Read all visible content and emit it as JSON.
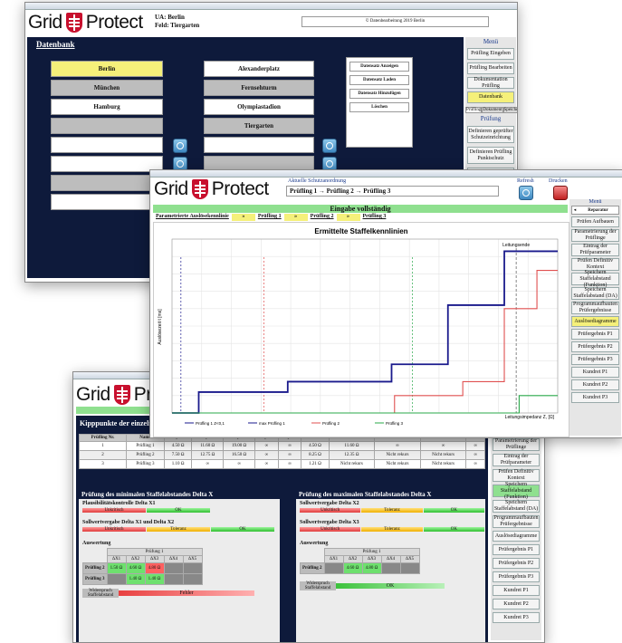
{
  "colors": {
    "navy": "#0e1a3b",
    "yellow": "#f5f07a",
    "green": "#8fe08f",
    "red": "#c8102e",
    "blue_series": "#1a1a8c",
    "red_series": "#e05050",
    "green_series": "#2aa84a"
  },
  "back_window": {
    "logo": {
      "left": "Grid",
      "right": "Protect"
    },
    "header_info": {
      "line1": "UA: Berlin",
      "line2": "Feld: Tiergarten"
    },
    "header_field": "© Datenbearbeitung 2019 Berlin",
    "db_title": "Datenbank",
    "col1": [
      "Berlin",
      "München",
      "Hamburg",
      "",
      ""
    ],
    "col2": [
      "Alexanderplatz",
      "Fernsehturm",
      "Olympiastadion",
      "Tiergarten",
      ""
    ],
    "actions": [
      "Datensatz Anzeigen",
      "Datensatz Laden",
      "Datensatz Hinzufügen",
      "Löschen"
    ],
    "menu_title": "Menü",
    "menu": [
      "Prüfling Eingeben",
      "Prüfling Bearbeiten",
      "Dokumentation Prüfling",
      "Datenbank"
    ],
    "tabs": [
      "Prüfling",
      "Dokument",
      "Speicher"
    ],
    "pruefung_title": "Prüfung",
    "pruefung_items": [
      "Definieren geprüfter Schutzeinrichtung",
      "Definieren Prüfling Punktschutz",
      "Definieren Prüfling Reserveschutz"
    ]
  },
  "mid_window": {
    "logo": {
      "left": "Grid",
      "right": "Protect"
    },
    "top_label": "Aktuelle Schutzanordnung",
    "sequence": "Prüfling 1 → Prüfling 2 → Prüfling 3",
    "icons": [
      {
        "label": "Refresh"
      },
      {
        "label": "Drucken"
      }
    ],
    "status_bar": "Eingabe vollständig",
    "param_row": {
      "label": "Parametrierte Auslösekennlinie",
      "items": [
        "Prüfling 1",
        "Prüfling 2",
        "Prüfling 3"
      ]
    },
    "chart_title": "Ermittelte Staffelkennlinien",
    "menu_title": "Menü",
    "menu_selected": "Reparatur",
    "menu": [
      "Prüfen Aufbauen",
      "Parametrierung der Prüflinge",
      "Eintrag der Prüfparameter",
      "Prüfen Definitiv Kontext",
      "Speichern Staffelabstand (Funktion)",
      "Speichern Staffelabstand (DA)",
      "Programmaufbauten Prüfergebnisse",
      "Auslösediagramme",
      "Prüfergebnis P1",
      "Prüfergebnis P2",
      "Prüfergebnis P3",
      "Kundret P1",
      "Kundret P2",
      "Kundret P3"
    ],
    "menu_highlight_index": 7
  },
  "chart_data": {
    "type": "line",
    "title": "Ermittelte Staffelkennlinien",
    "xlabel": "Leitungsimpedanz Z, [Ω]",
    "ylabel": "Auslösezeit t [ms]",
    "xlim": [
      0,
      13
    ],
    "ylim": [
      0,
      1000
    ],
    "annotation": "Leitungsende",
    "series": [
      {
        "name": "Prüfling 1",
        "color": "#1a1a8c",
        "x": [
          0,
          0.9,
          0.9,
          3.9,
          3.9,
          7.4,
          7.4,
          9.3,
          9.3,
          11.2,
          11.2,
          13
        ],
        "y": [
          0,
          0,
          120,
          120,
          180,
          180,
          280,
          280,
          620,
          620,
          930,
          930
        ]
      },
      {
        "name": "Prüfling 2",
        "color": "#e05050",
        "x": [
          0,
          7.5,
          7.5,
          9.8,
          9.8,
          11.2,
          11.2,
          12.3,
          12.3,
          13
        ],
        "y": [
          0,
          0,
          100,
          100,
          180,
          180,
          600,
          600,
          820,
          820
        ]
      },
      {
        "name": "Prüfling 3",
        "color": "#2aa84a",
        "x": [
          0,
          11.7,
          11.7,
          13
        ],
        "y": [
          0,
          0,
          100,
          100
        ]
      }
    ],
    "legend": [
      "Prüfling 1 Z<0,1",
      "max Prüfling 1",
      "Prüfling 2",
      "Prüfling 3"
    ]
  },
  "front_window": {
    "logo": {
      "left": "Grid",
      "right": "Prot"
    },
    "section_title": "Kipppunkte der einzelnen",
    "table_headers": [
      "Prüfling Nr.",
      "Name",
      "Zyk1",
      "Zyk2",
      "Zyk3",
      "Zyk4",
      "Zyk5",
      "Ph1",
      "Ph2",
      "Ph3",
      "Ph4",
      "Ph5"
    ],
    "table_rows": [
      [
        "1",
        "Prüfling 1",
        "4.50 Ω",
        "11.60 Ω",
        "19.00 Ω",
        "∞",
        "∞",
        "4.50 Ω",
        "11.60 Ω",
        "∞",
        "∞",
        "∞"
      ],
      [
        "2",
        "Prüfling 2",
        "7.50 Ω",
        "12.75 Ω",
        "16.50 Ω",
        "∞",
        "∞",
        "8.25 Ω",
        "12.35 Ω",
        "Nicht rekurs",
        "Nicht rekurs",
        "∞"
      ],
      [
        "3",
        "Prüfling 3",
        "1.10 Ω",
        "∞",
        "∞",
        "∞",
        "∞",
        "1.21 Ω",
        "Nicht rekurs",
        "Nicht rekurs",
        "Nicht rekurs",
        "∞"
      ]
    ],
    "left_panel": {
      "title": "Prüfung des minimalen Staffelabstandes Delta X",
      "sub1": "Plausibilitätskontrolle Delta X1",
      "sub2": "Sollwertvergabe Delta X1 und Delta X2",
      "eval_title": "Auswertung",
      "eval_header": "Prüfung 1",
      "eval_cols": [
        "ΔX1",
        "ΔX2",
        "ΔX3",
        "ΔX4",
        "ΔX5"
      ],
      "eval_rows": [
        {
          "label": "Prüfling 2",
          "vals": [
            "1.50 Ω",
            "4.60 Ω",
            "4.80 Ω",
            "",
            ""
          ]
        },
        {
          "label": "Prüfling 3",
          "vals": [
            "",
            "1.40 Ω",
            "1.40 Ω",
            "",
            ""
          ]
        }
      ],
      "status_label": "Widerspruch Staffelabstand",
      "status_value": "Fehler",
      "bars": [
        "Unkritisch",
        "OK",
        "Unkritisch",
        "Toleranz",
        "OK"
      ]
    },
    "right_panel": {
      "title": "Prüfung des maximalen Staffelabstandes Delta X",
      "sub1": "Sollwertvergabe Delta X2",
      "sub2": "Sollwertvergabe Delta X3",
      "eval_title": "Auswertung",
      "eval_header": "Prüfung 1",
      "eval_cols": [
        "ΔX1",
        "ΔX2",
        "ΔX3",
        "ΔX4",
        "ΔX5"
      ],
      "eval_rows": [
        {
          "label": "Prüfling 2",
          "vals": [
            "",
            "4.60 Ω",
            "4.80 Ω",
            "",
            ""
          ]
        }
      ],
      "status_label": "Widerspruch Staffelabstand",
      "status_value": "OK",
      "bars": [
        "Unkritisch",
        "Toleranz",
        "OK",
        "Unkritisch",
        "Toleranz",
        "OK"
      ]
    },
    "menu": [
      "Parametrierung der Prüflinge",
      "Eintrag der Prüfparameter",
      "Prüfen Definitiv Kontext",
      "Speichern Staffelabstand (Funktion)",
      "Speichern Staffelabstand (DA)",
      "Programmaufbauten Prüfergebnisse",
      "Auslösediagramme",
      "Prüfergebnis P1",
      "Prüfergebnis P2",
      "Prüfergebnis P3",
      "Kundret P1",
      "Kundret P2",
      "Kundret P3"
    ],
    "menu_highlight_index": 3
  }
}
